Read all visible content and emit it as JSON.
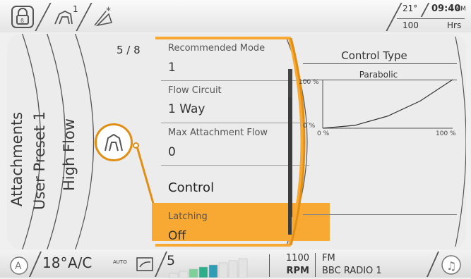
{
  "topbar": {
    "lock_icon": "lock-icon",
    "attachment_icon": "attachment-grapple-icon",
    "attachment_number": "1",
    "wiper_icon": "wiper-icon",
    "temperature": "21°",
    "clock_time": "09:40",
    "clock_ampm": "AM",
    "hours_value": "100",
    "hours_unit": "Hrs"
  },
  "side_tabs": [
    "Attachments",
    "User Preset 1",
    "High Flow"
  ],
  "selected_icon": "grapple-icon",
  "page_counter": "5 / 8",
  "fields": [
    {
      "label": "Recommended Mode",
      "value": "1"
    },
    {
      "label": "Flow Circuit",
      "value": "1 Way"
    },
    {
      "label": "Max Attachment Flow",
      "value": "0"
    }
  ],
  "selected_item": "Control",
  "latching": {
    "label": "Latching",
    "value": "Off"
  },
  "control_type": {
    "title": "Control Type",
    "curve_name": "Parabolic"
  },
  "chart_data": {
    "type": "line",
    "title": "Parabolic",
    "x_ticks": [
      "0 %",
      "100 %"
    ],
    "y_ticks": [
      "0 %",
      "100 %"
    ],
    "xlim": [
      0,
      100
    ],
    "ylim": [
      0,
      100
    ],
    "series": [
      {
        "x": [
          0,
          25,
          50,
          75,
          100
        ],
        "y": [
          0,
          6,
          25,
          56,
          100
        ]
      }
    ]
  },
  "bottombar": {
    "climate_a_icon": "auto-climate-icon",
    "cabin_temp": "18°",
    "ac_label": "A/C",
    "auto_label": "AUTO",
    "fan_icon": "fan-airflow-icon",
    "fan_speed": "5",
    "fan_level": 0.6,
    "rpm_value": "1100",
    "rpm_unit": "RPM",
    "radio_band": "FM",
    "radio_station": "BBC RADIO 1",
    "music_icon": "music-note-icon"
  },
  "colors": {
    "accent": "#f7a934",
    "accent_border": "#e08f14"
  }
}
